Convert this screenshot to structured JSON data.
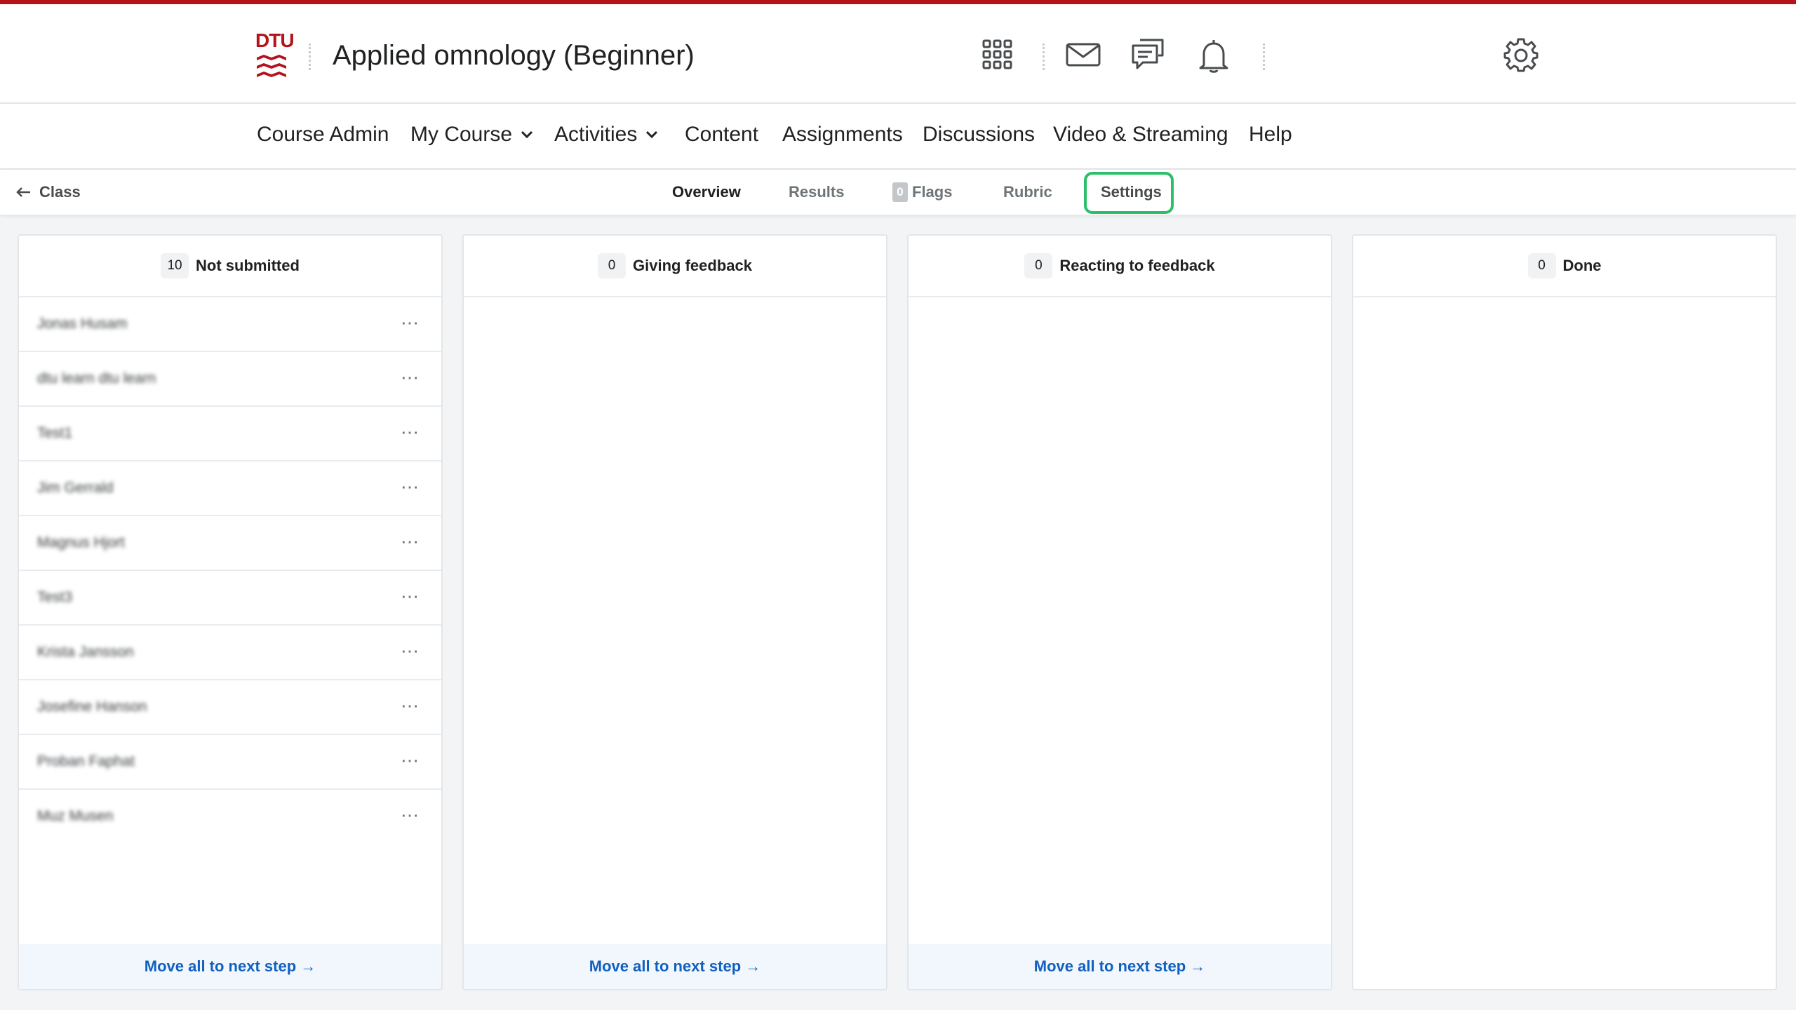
{
  "header": {
    "logo_text": "DTU",
    "course_title": "Applied omnology (Beginner)",
    "icons": [
      "apps-grid-icon",
      "mail-icon",
      "chat-icon",
      "bell-icon",
      "gear-icon"
    ]
  },
  "nav": {
    "items": [
      {
        "label": "Course Admin",
        "dropdown": false
      },
      {
        "label": "My Course",
        "dropdown": true
      },
      {
        "label": "Activities",
        "dropdown": true
      },
      {
        "label": "Content",
        "dropdown": false
      },
      {
        "label": "Assignments",
        "dropdown": false
      },
      {
        "label": "Discussions",
        "dropdown": false
      },
      {
        "label": "Video & Streaming",
        "dropdown": false
      },
      {
        "label": "Help",
        "dropdown": false
      }
    ]
  },
  "subnav": {
    "back_label": "Class",
    "tabs": [
      {
        "label": "Overview",
        "active": true
      },
      {
        "label": "Results",
        "active": false
      },
      {
        "label": "Flags",
        "count": "0",
        "active": false
      },
      {
        "label": "Rubric",
        "active": false
      },
      {
        "label": "Settings",
        "active": false,
        "highlighted": true
      }
    ]
  },
  "columns": [
    {
      "count": "10",
      "title": "Not submitted",
      "rows": [
        "Jonas Husam",
        "dtu learn dtu learn",
        "Test1",
        "Jim Gerrald",
        "Magnus Hjort",
        "Test3",
        "Krista Jansson",
        "Josefine Hanson",
        "Proban Faphat",
        "Muz Musen"
      ],
      "footer": "Move all to next step →"
    },
    {
      "count": "0",
      "title": "Giving feedback",
      "rows": [],
      "footer": "Move all to next step →"
    },
    {
      "count": "0",
      "title": "Reacting to feedback",
      "rows": [],
      "footer": "Move all to next step →"
    },
    {
      "count": "0",
      "title": "Done",
      "rows": [],
      "footer": ""
    }
  ],
  "colors": {
    "brand_red": "#b5121b",
    "highlight_green": "#2bbf6a",
    "link_blue": "#1060c0"
  }
}
